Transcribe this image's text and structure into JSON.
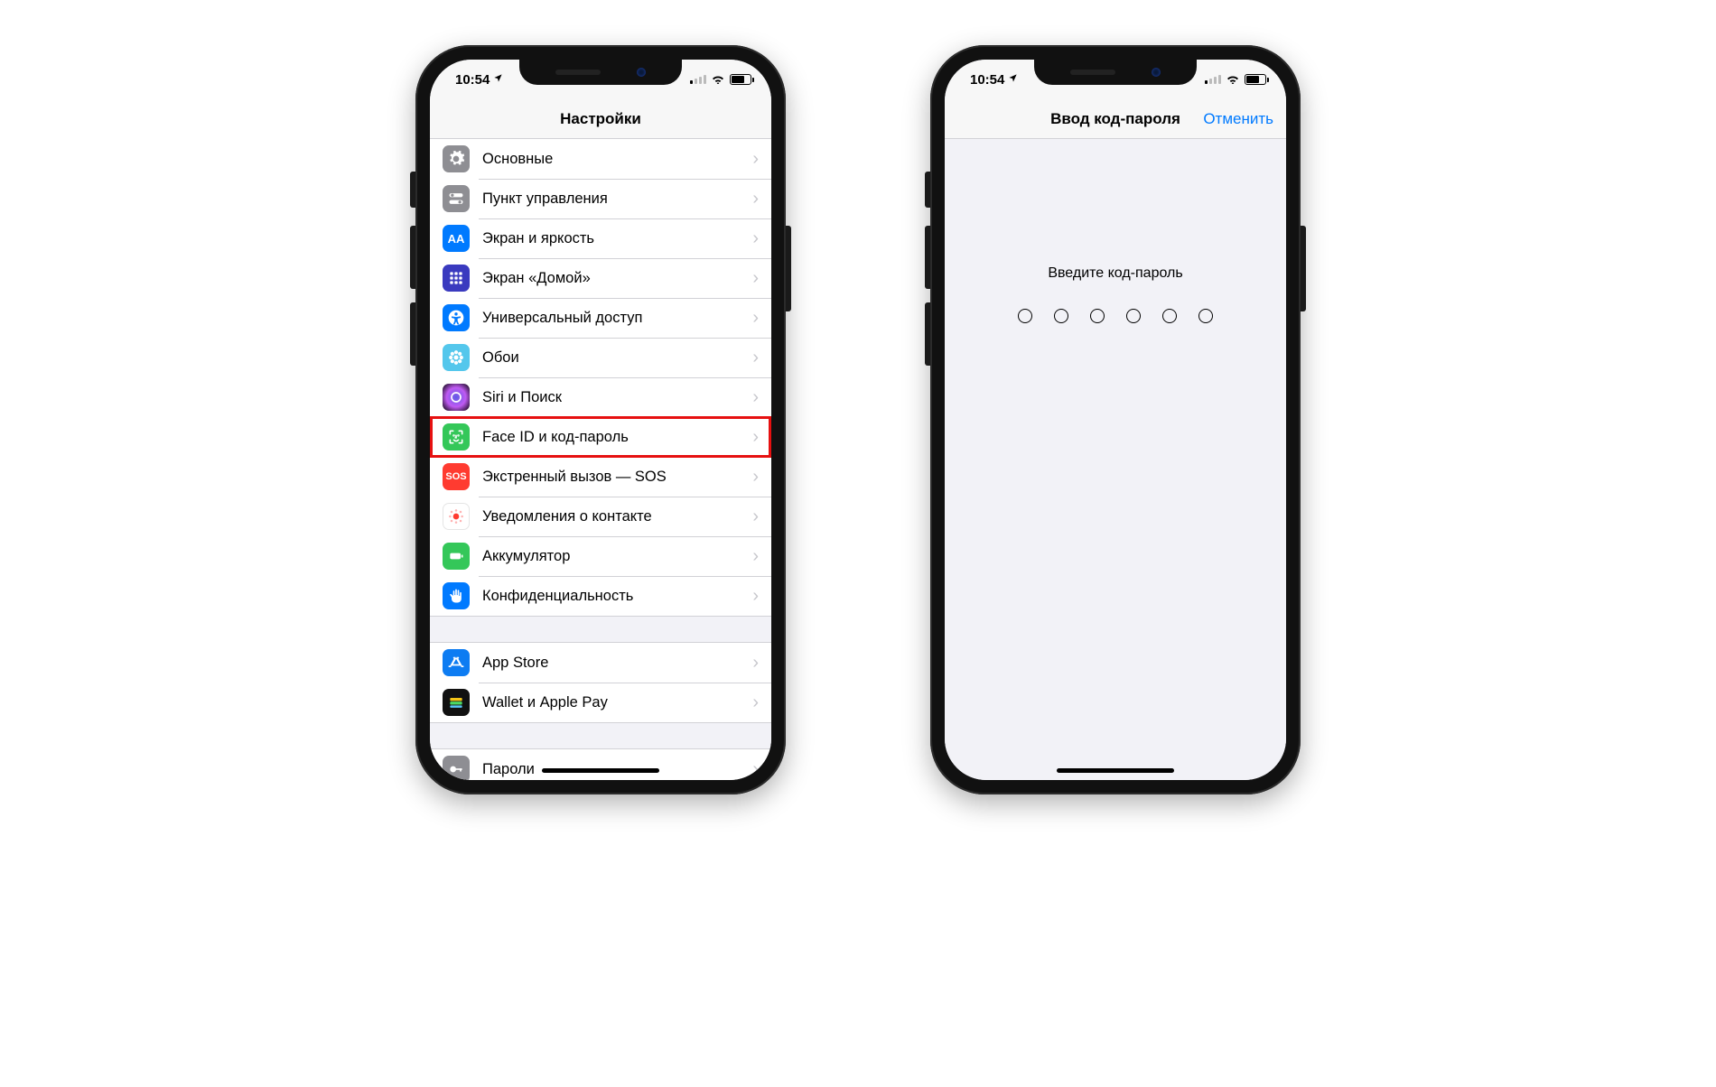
{
  "status": {
    "time": "10:54",
    "location_icon": "◤"
  },
  "phone1": {
    "header_title": "Настройки",
    "sections": [
      [
        {
          "icon": "gear",
          "label": "Основные"
        },
        {
          "icon": "switches",
          "label": "Пункт управления"
        },
        {
          "icon": "aa",
          "label": "Экран и яркость"
        },
        {
          "icon": "home-grid",
          "label": "Экран «Домой»"
        },
        {
          "icon": "accessibility",
          "label": "Универсальный доступ"
        },
        {
          "icon": "flower",
          "label": "Обои"
        },
        {
          "icon": "siri",
          "label": "Siri и Поиск"
        },
        {
          "icon": "faceid",
          "label": "Face ID и код-пароль",
          "highlighted": true
        },
        {
          "icon": "sos",
          "label": "Экстренный вызов — SOS"
        },
        {
          "icon": "exposure",
          "label": "Уведомления о контакте"
        },
        {
          "icon": "battery",
          "label": "Аккумулятор"
        },
        {
          "icon": "hand",
          "label": "Конфиденциальность"
        }
      ],
      [
        {
          "icon": "appstore",
          "label": "App Store"
        },
        {
          "icon": "wallet",
          "label": "Wallet и Apple Pay"
        }
      ],
      [
        {
          "icon": "keys",
          "label": "Пароли"
        }
      ]
    ]
  },
  "phone2": {
    "header_title": "Ввод код-пароля",
    "cancel": "Отменить",
    "prompt": "Введите код-пароль",
    "digits": 6
  }
}
